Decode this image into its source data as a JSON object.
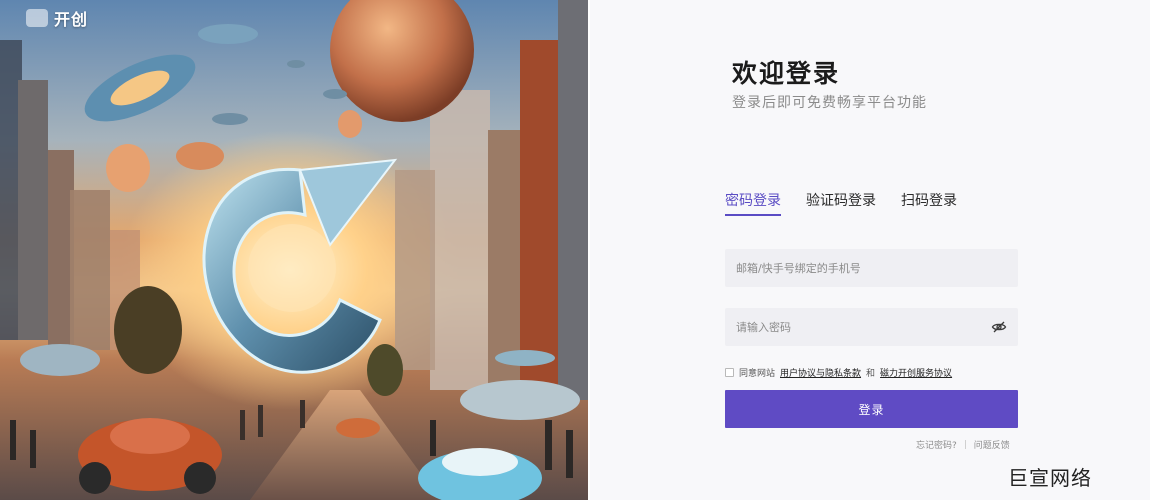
{
  "brand": {
    "logo_text": "开创"
  },
  "login": {
    "title": "欢迎登录",
    "subtitle": "登录后即可免费畅享平台功能",
    "tabs": [
      {
        "label": "密码登录",
        "active": true
      },
      {
        "label": "验证码登录",
        "active": false
      },
      {
        "label": "扫码登录",
        "active": false
      }
    ],
    "email_placeholder": "邮箱/快手号绑定的手机号",
    "password_placeholder": "请输入密码",
    "agreement": {
      "prefix": "同意网站",
      "link1": "用户协议与隐私条款",
      "conjunction": "和",
      "link2": "磁力开创服务协议"
    },
    "submit_label": "登录",
    "forgot_label": "忘记密码?",
    "feedback_label": "问题反馈"
  },
  "watermark": "巨宣网络",
  "colors": {
    "accent": "#5f4bc4",
    "tab_active": "#5a4cc4",
    "field_bg": "#efeff3"
  },
  "icons": {
    "password_toggle": "eye-off-icon"
  }
}
